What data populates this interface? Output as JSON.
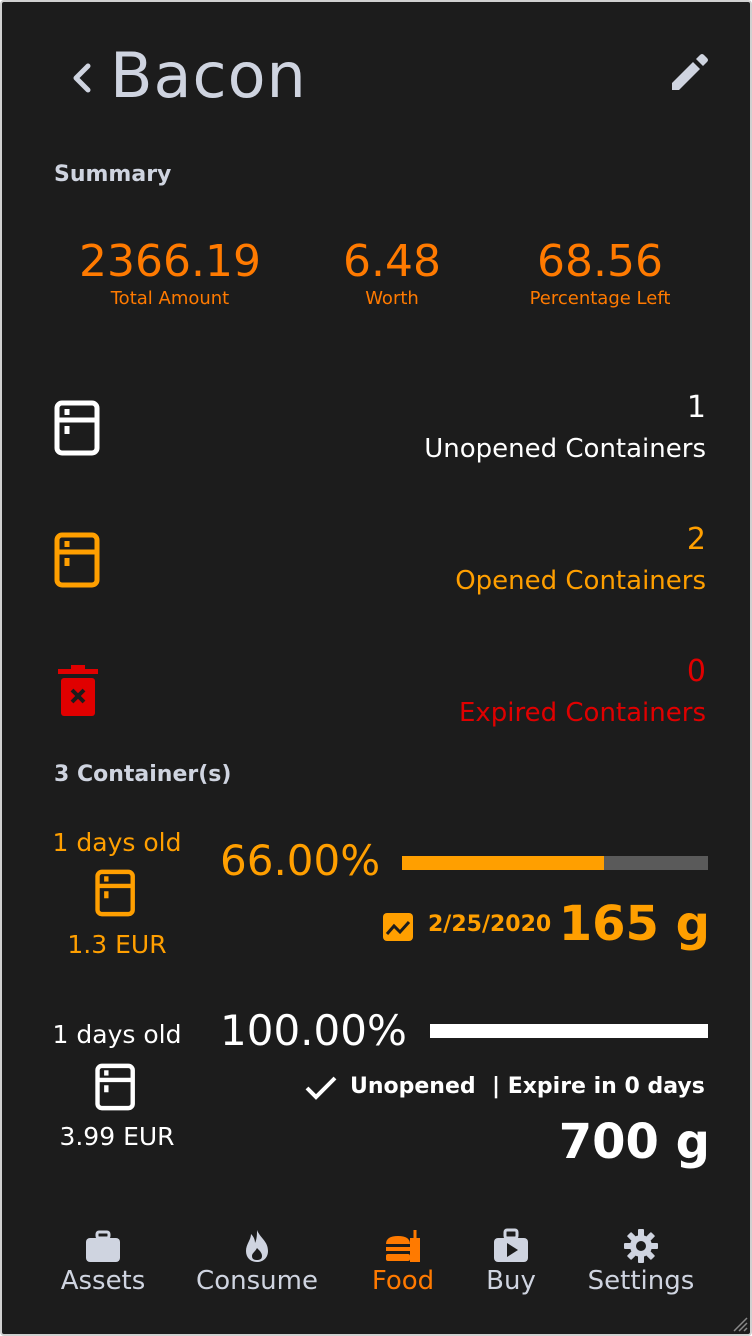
{
  "header": {
    "title": "Bacon"
  },
  "summary": {
    "label": "Summary",
    "items": [
      {
        "value": "2366.19",
        "caption": "Total Amount"
      },
      {
        "value": "6.48",
        "caption": "Worth"
      },
      {
        "value": "68.56",
        "caption": "Percentage Left"
      }
    ]
  },
  "stats": {
    "unopened": {
      "count": "1",
      "label": "Unopened Containers"
    },
    "opened": {
      "count": "2",
      "label": "Opened Containers"
    },
    "expired": {
      "count": "0",
      "label": "Expired Containers"
    }
  },
  "containers_label": "3 Container(s)",
  "containers": [
    {
      "age": "1 days old",
      "price": "1.3 EUR",
      "percent": "66.00%",
      "fill": 0.66,
      "date": "2/25/2020",
      "weight": "165 g",
      "color": "#ff9f00"
    },
    {
      "age": "1 days old",
      "price": "3.99 EUR",
      "percent": "100.00%",
      "fill": 1.0,
      "status": "Unopened",
      "expire": "| Expire in 0 days",
      "weight": "700 g",
      "color": "#ffffff"
    }
  ],
  "nav": {
    "items": [
      {
        "label": "Assets",
        "icon": "briefcase-icon"
      },
      {
        "label": "Consume",
        "icon": "flame-icon"
      },
      {
        "label": "Food",
        "icon": "food-icon",
        "active": true
      },
      {
        "label": "Buy",
        "icon": "shopping-bag-icon"
      },
      {
        "label": "Settings",
        "icon": "gear-icon"
      }
    ]
  },
  "colors": {
    "accent": "#ff9f00",
    "summary": "#ff7a00",
    "danger": "#e00000",
    "background": "#1c1c1c",
    "muted": "#cfd4e0"
  }
}
